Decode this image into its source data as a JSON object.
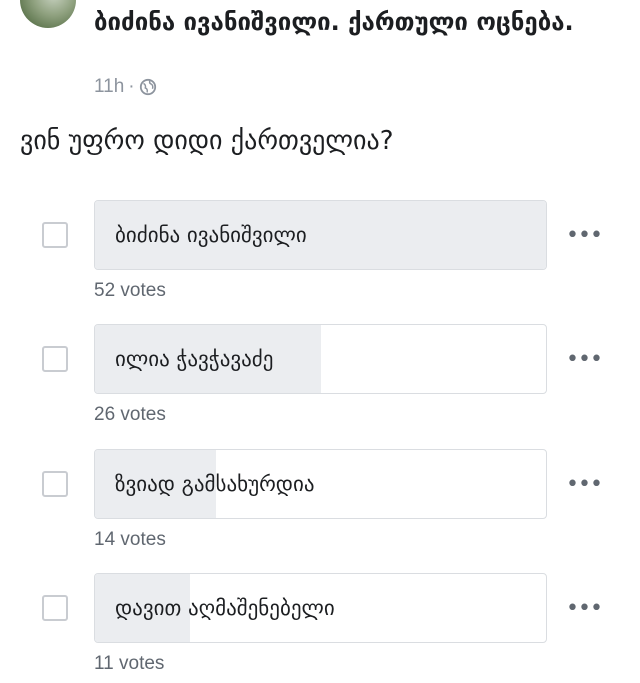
{
  "post": {
    "author": "ბიძინა ივანიშვილი. ქართული ოცნება.",
    "time": "11h",
    "separator": "·",
    "privacy_icon": "globe-icon"
  },
  "poll": {
    "question": "ვინ უფრო დიდი ქართველია?",
    "max_votes": 52,
    "options": [
      {
        "label": "ბიძინა ივანიშვილი",
        "votes": 52,
        "votes_text": "52 votes"
      },
      {
        "label": "ილია ჭავჭავაძე",
        "votes": 26,
        "votes_text": "26 votes"
      },
      {
        "label": "ზვიად გამსახურდია",
        "votes": 14,
        "votes_text": "14 votes"
      },
      {
        "label": "დავით აღმაშენებელი",
        "votes": 11,
        "votes_text": "11 votes"
      }
    ],
    "more_icon": "ellipsis-icon",
    "more_label": "•••"
  },
  "colors": {
    "bar_fill": "#ebedf0",
    "bar_border": "#dadde1",
    "muted": "#606770"
  }
}
